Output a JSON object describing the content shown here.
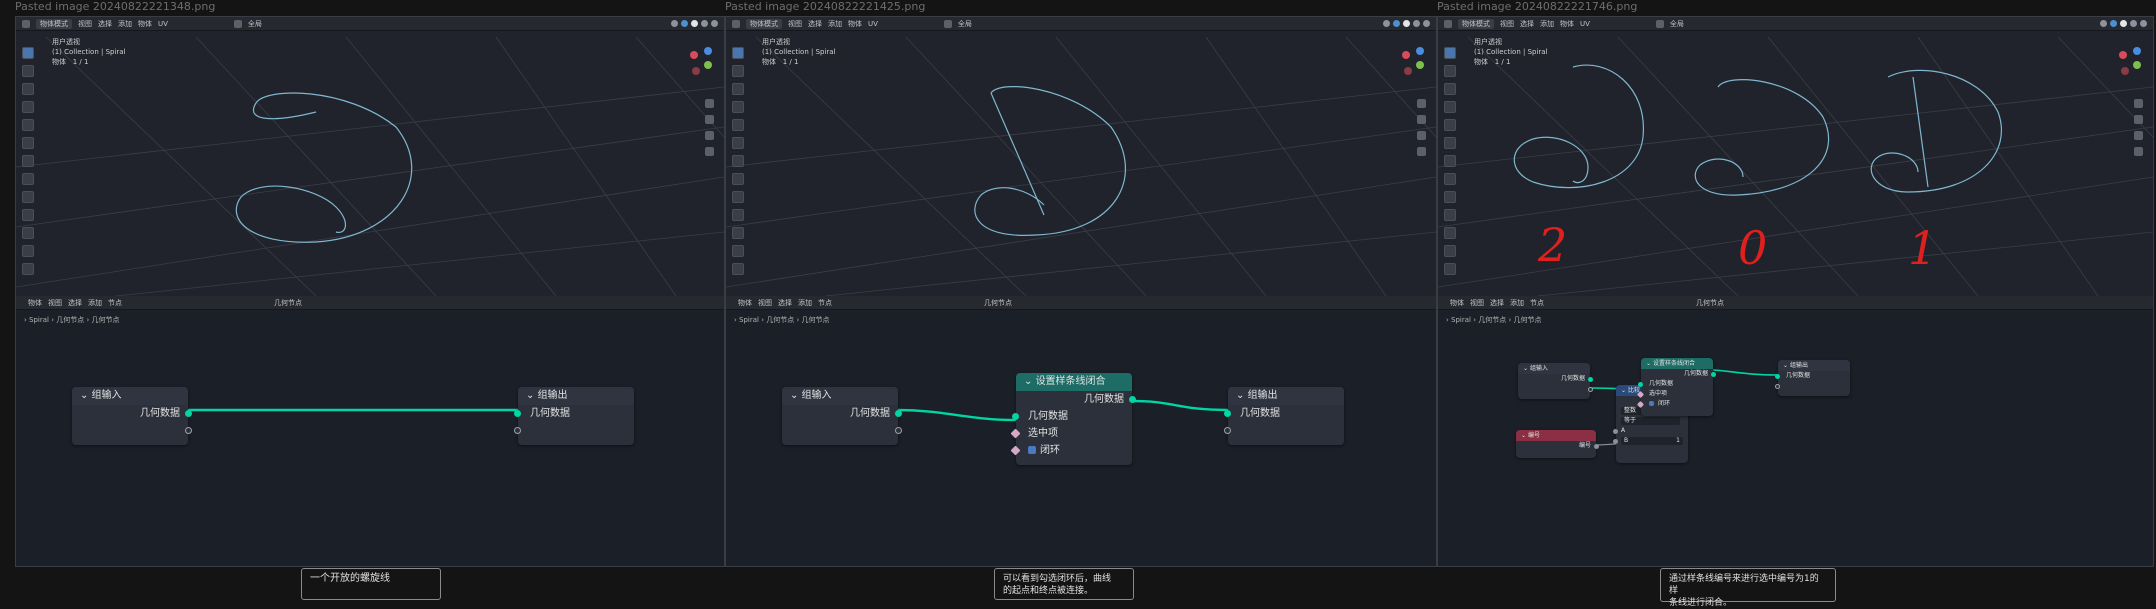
{
  "panels": [
    {
      "title": "Pasted image 20240822221348.png",
      "viewport": {
        "mode": "物体模式",
        "menus": [
          "视图",
          "选择",
          "添加",
          "物体",
          "UV"
        ],
        "transform": "全局",
        "view_name": "用户透视",
        "collection": "(1) Collection | Spiral",
        "stats": "物体",
        "stats_value": "1 / 1"
      },
      "node_editor": {
        "editor": "物体",
        "menus": [
          "视图",
          "选择",
          "添加",
          "节点"
        ],
        "tree": "几何节点",
        "breadcrumb": [
          "Spiral",
          "几何节点",
          "几何节点"
        ]
      },
      "nodes": {
        "input": {
          "title": "组输入",
          "socket": "几何数据"
        },
        "output": {
          "title": "组输出",
          "socket": "几何数据"
        }
      },
      "caption": "一个开放的螺旋线"
    },
    {
      "title": "Pasted image 20240822221425.png",
      "viewport": {
        "mode": "物体模式",
        "menus": [
          "视图",
          "选择",
          "添加",
          "物体",
          "UV"
        ],
        "transform": "全局",
        "view_name": "用户透视",
        "collection": "(1) Collection | Spiral",
        "stats": "物体",
        "stats_value": "1 / 1"
      },
      "node_editor": {
        "editor": "物体",
        "menus": [
          "视图",
          "选择",
          "添加",
          "节点"
        ],
        "tree": "几何节点",
        "breadcrumb": [
          "Spiral",
          "几何节点",
          "几何节点"
        ]
      },
      "nodes": {
        "input": {
          "title": "组输入",
          "socket": "几何数据"
        },
        "set": {
          "title": "设置样条线闭合",
          "out": "几何数据",
          "in": "几何数据",
          "selection": "选中项",
          "cyclic": "闭环"
        },
        "output": {
          "title": "组输出",
          "socket": "几何数据"
        }
      },
      "caption_lines": [
        "可以看到勾选闭环后，曲线",
        "的起点和终点被连接。"
      ]
    },
    {
      "title": "Pasted image 20240822221746.png",
      "viewport": {
        "mode": "物体模式",
        "menus": [
          "视图",
          "选择",
          "添加",
          "物体",
          "UV"
        ],
        "transform": "全局",
        "view_name": "用户透视",
        "collection": "(1) Collection | Spiral",
        "stats": "物体",
        "stats_value": "1 / 1",
        "annotations": [
          "2",
          "0",
          "1"
        ]
      },
      "node_editor": {
        "editor": "物体",
        "menus": [
          "视图",
          "选择",
          "添加",
          "节点"
        ],
        "tree": "几何节点",
        "breadcrumb": [
          "Spiral",
          "几何节点",
          "几何节点"
        ]
      },
      "nodes": {
        "input": {
          "title": "组输入",
          "socket": "几何数据"
        },
        "set": {
          "title": "设置样条线闭合",
          "out": "几何数据",
          "in": "几何数据",
          "selection": "选中项",
          "cyclic": "闭环"
        },
        "compare": {
          "title": "比较",
          "out": "结果",
          "type": "整数",
          "op": "等于",
          "a": "A",
          "b": "B",
          "b_value": "1"
        },
        "index": {
          "title": "编号",
          "out": "编号"
        },
        "output": {
          "title": "组输出",
          "socket": "几何数据"
        }
      },
      "caption_lines": [
        "通过样条线编号来进行选中编号为1的样",
        "条线进行闭合。"
      ]
    }
  ],
  "colors": {
    "geometry_link": "#00d6a3",
    "curve": "#7fb7cf",
    "annotation": "#e0201e",
    "set_node_header": "#1d6c66"
  }
}
